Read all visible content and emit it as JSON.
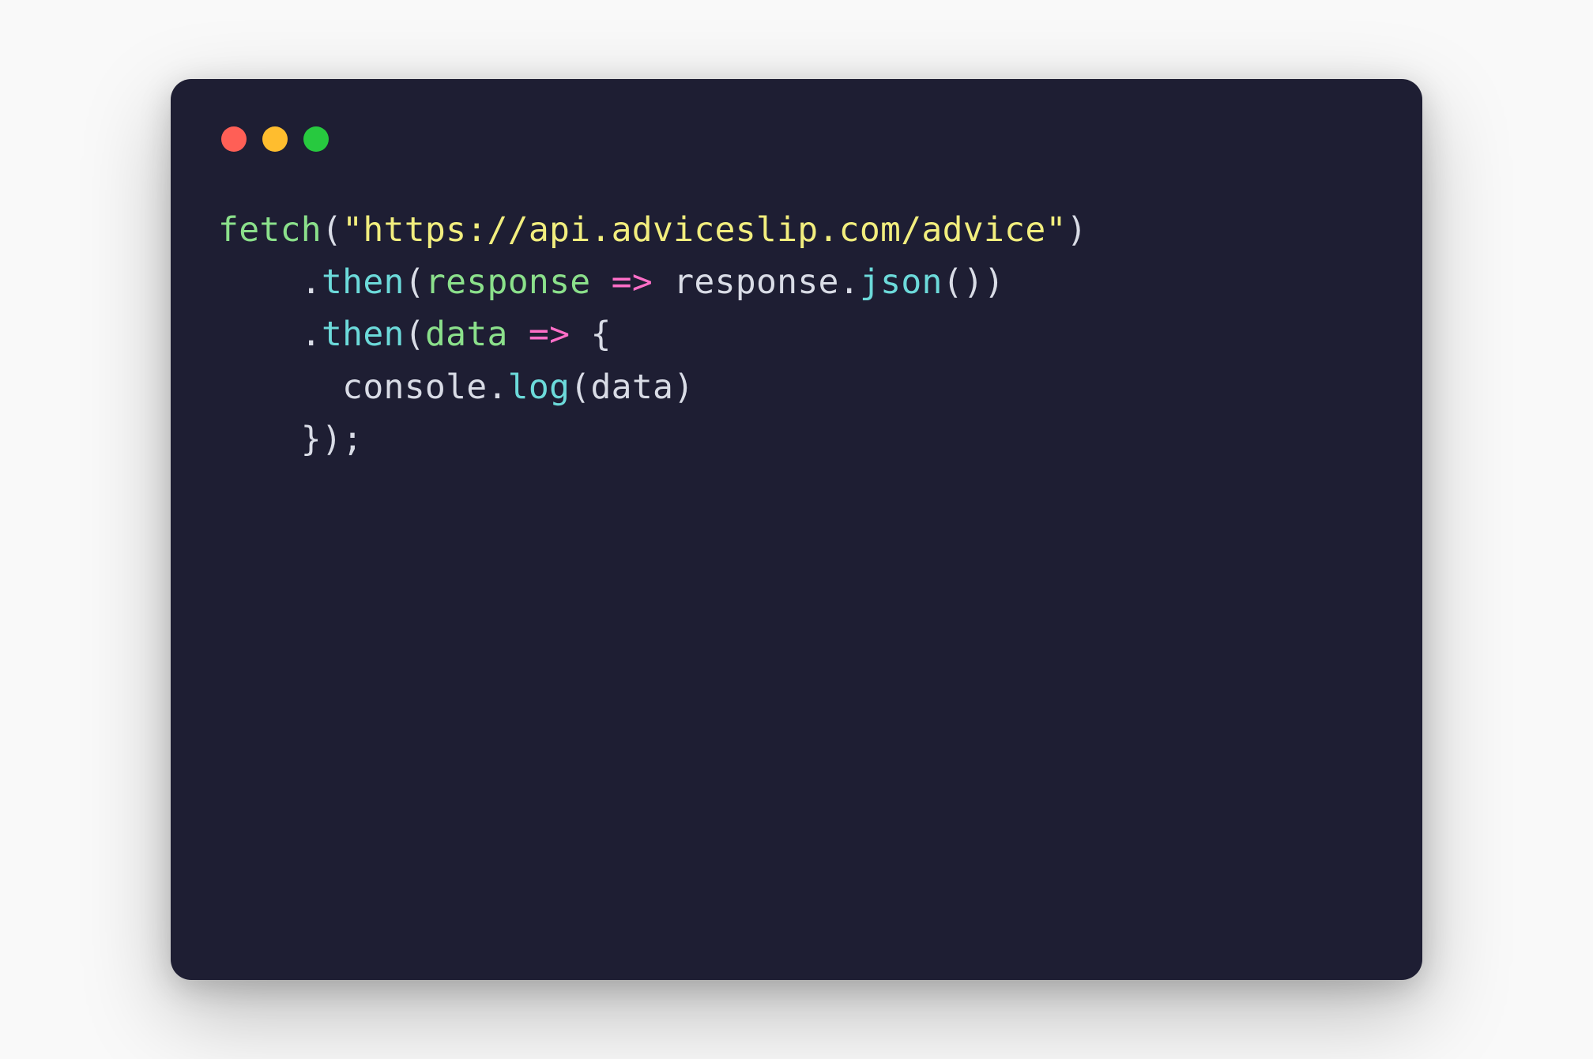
{
  "window": {
    "traffic_lights": {
      "close": "close-window",
      "minimize": "minimize-window",
      "maximize": "maximize-window"
    }
  },
  "code": {
    "line1": {
      "fn": "fetch",
      "open_paren": "(",
      "str": "\"https://api.adviceslip.com/advice\"",
      "close_paren": ")"
    },
    "line2": {
      "indent": "    ",
      "dot": ".",
      "method": "then",
      "open_paren": "(",
      "param": "response",
      "arrow": " => ",
      "ident": "response",
      "dot2": ".",
      "method2": "json",
      "parens": "()",
      "close_paren": ")"
    },
    "line3": {
      "indent": "    ",
      "dot": ".",
      "method": "then",
      "open_paren": "(",
      "param": "data",
      "arrow": " => ",
      "brace": "{"
    },
    "line4": {
      "indent": "      ",
      "obj": "console",
      "dot": ".",
      "method": "log",
      "open_paren": "(",
      "arg": "data",
      "close_paren": ")"
    },
    "line5": {
      "indent": "    ",
      "text": "});"
    }
  }
}
